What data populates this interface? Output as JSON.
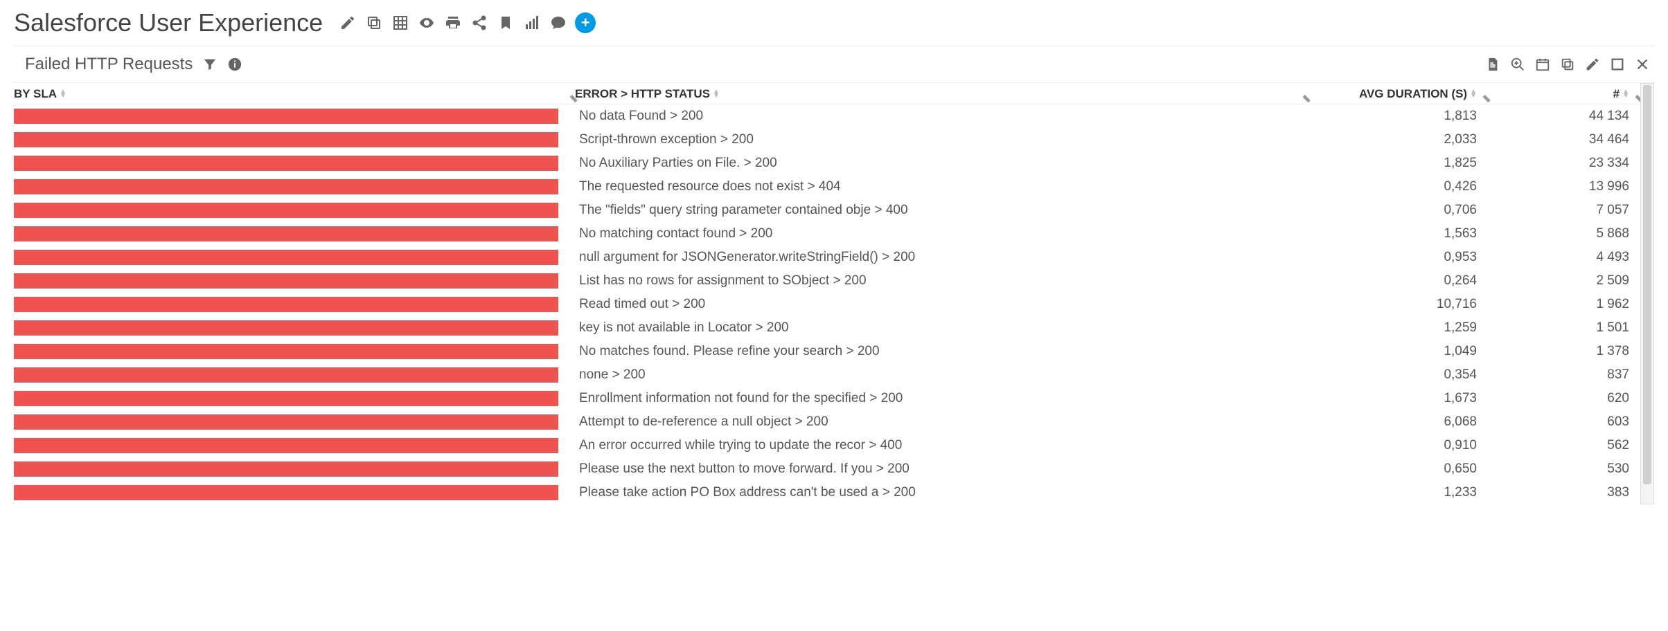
{
  "header": {
    "title": "Salesforce User Experience",
    "icons": [
      "edit",
      "copy",
      "grid",
      "eye",
      "print",
      "share",
      "bookmark",
      "signal",
      "comment",
      "add"
    ]
  },
  "widget": {
    "subtitle": "Failed HTTP Requests",
    "left_icons": [
      "filter",
      "info"
    ],
    "right_icons": [
      "save",
      "zoom",
      "calendar",
      "copy",
      "edit",
      "maximize",
      "close"
    ]
  },
  "columns": {
    "c1": "BY SLA",
    "c2": "ERROR > HTTP STATUS",
    "c3": "AVG DURATION (S)",
    "c4": "#"
  },
  "chart_data": {
    "type": "table",
    "title": "Failed HTTP Requests",
    "columns": [
      "error_http_status",
      "avg_duration_s",
      "count"
    ],
    "rows": [
      {
        "error": "No data Found > 200",
        "avg_duration": "1,813",
        "count": "44 134"
      },
      {
        "error": "Script-thrown exception > 200",
        "avg_duration": "2,033",
        "count": "34 464"
      },
      {
        "error": "No Auxiliary Parties on File. > 200",
        "avg_duration": "1,825",
        "count": "23 334"
      },
      {
        "error": "The requested resource does not exist > 404",
        "avg_duration": "0,426",
        "count": "13 996"
      },
      {
        "error": "The \"fields\" query string parameter contained obje > 400",
        "avg_duration": "0,706",
        "count": "7 057"
      },
      {
        "error": "No matching contact found > 200",
        "avg_duration": "1,563",
        "count": "5 868"
      },
      {
        "error": "null argument for JSONGenerator.writeStringField() > 200",
        "avg_duration": "0,953",
        "count": "4 493"
      },
      {
        "error": "List has no rows for assignment to SObject > 200",
        "avg_duration": "0,264",
        "count": "2 509"
      },
      {
        "error": "Read timed out > 200",
        "avg_duration": "10,716",
        "count": "1 962"
      },
      {
        "error": "key is not available in Locator > 200",
        "avg_duration": "1,259",
        "count": "1 501"
      },
      {
        "error": "No matches found. Please refine your search > 200",
        "avg_duration": "1,049",
        "count": "1 378"
      },
      {
        "error": "none > 200",
        "avg_duration": "0,354",
        "count": "837"
      },
      {
        "error": "Enrollment information not found for the specified > 200",
        "avg_duration": "1,673",
        "count": "620"
      },
      {
        "error": "Attempt to de-reference a null object > 200",
        "avg_duration": "6,068",
        "count": "603"
      },
      {
        "error": "An error occurred while trying to update the recor > 400",
        "avg_duration": "0,910",
        "count": "562"
      },
      {
        "error": "Please use the next button to move forward. If you > 200",
        "avg_duration": "0,650",
        "count": "530"
      },
      {
        "error": "Please take action PO Box address can't be used a > 200",
        "avg_duration": "1,233",
        "count": "383"
      }
    ]
  }
}
